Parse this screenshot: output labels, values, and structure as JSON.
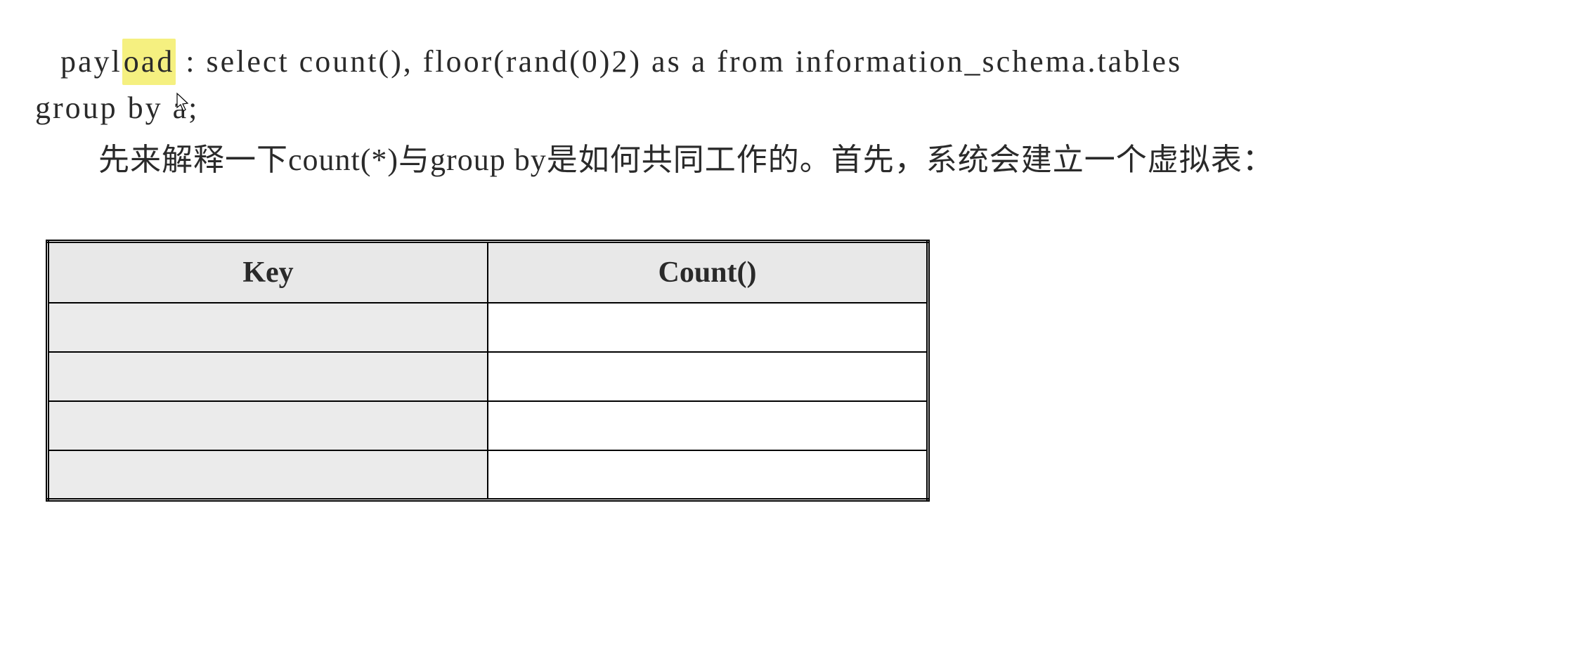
{
  "payload": {
    "label": "payload",
    "separator": " : ",
    "sql_before": "payl",
    "sql_highlight": "oad",
    "sql_first_line": " : select count(), floor(rand(0)2) as a from information_schema.tables",
    "sql_wrap": "group by a;"
  },
  "explanation_indent": "　　",
  "explanation": "先来解释一下count(*)与group by是如何共同工作的。首先，系统会建立一个虚拟表：",
  "table": {
    "headers": {
      "key": "Key",
      "count": "Count()"
    },
    "rows": [
      {
        "key": "",
        "count": ""
      },
      {
        "key": "",
        "count": ""
      },
      {
        "key": "",
        "count": ""
      },
      {
        "key": "",
        "count": ""
      }
    ]
  }
}
